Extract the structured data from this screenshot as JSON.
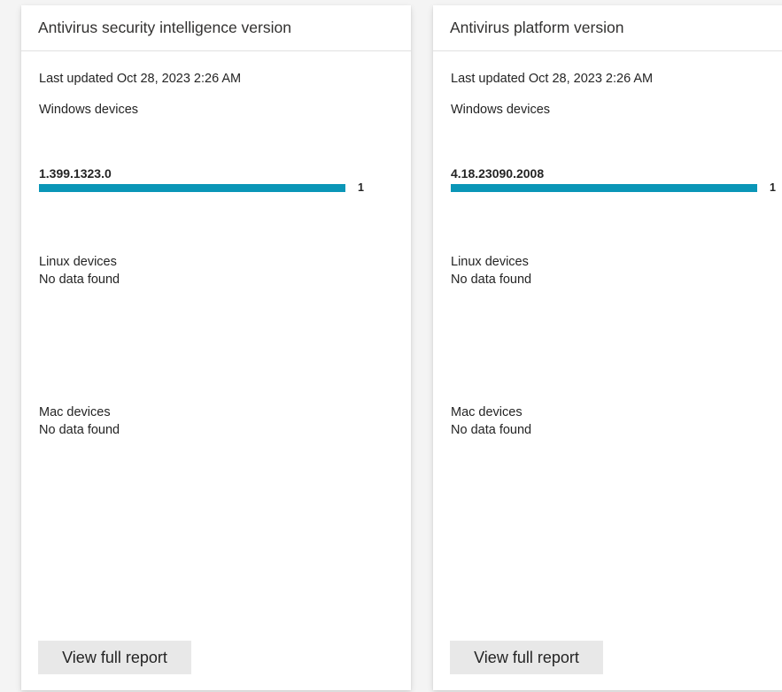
{
  "cards": [
    {
      "title": "Antivirus security intelligence version",
      "last_updated": "Last updated Oct 28, 2023 2:26 AM",
      "windows": {
        "label": "Windows devices",
        "version": "1.399.1323.0",
        "count": "1",
        "fill_fraction": 1.0
      },
      "linux": {
        "label": "Linux devices",
        "status": "No data found"
      },
      "mac": {
        "label": "Mac devices",
        "status": "No data found"
      },
      "button_label": "View full report"
    },
    {
      "title": "Antivirus platform version",
      "last_updated": "Last updated Oct 28, 2023 2:26 AM",
      "windows": {
        "label": "Windows devices",
        "version": "4.18.23090.2008",
        "count": "1",
        "fill_fraction": 1.0
      },
      "linux": {
        "label": "Linux devices",
        "status": "No data found"
      },
      "mac": {
        "label": "Mac devices",
        "status": "No data found"
      },
      "button_label": "View full report"
    }
  ],
  "colors": {
    "bar": "#0a96b7"
  }
}
